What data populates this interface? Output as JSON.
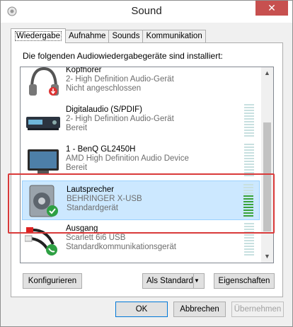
{
  "window": {
    "title": "Sound",
    "close_glyph": "✕"
  },
  "tabs": [
    {
      "label": "Wiedergabe",
      "active": true
    },
    {
      "label": "Aufnahme"
    },
    {
      "label": "Sounds"
    },
    {
      "label": "Kommunikation"
    }
  ],
  "instructions": "Die folgenden Audiowiedergabegeräte sind installiert:",
  "devices": [
    {
      "name": "Kopfhörer",
      "line1": "2- High Definition Audio-Gerät",
      "line2": "Nicht angeschlossen",
      "icon": "headphones-icon",
      "status_icon": "down-arrow-badge-icon"
    },
    {
      "name": "Digitalaudio (S/PDIF)",
      "line1": "2- High Definition Audio-Gerät",
      "line2": "Bereit",
      "icon": "digital-audio-icon"
    },
    {
      "name": "1 - BenQ GL2450H",
      "line1": "AMD High Definition Audio Device",
      "line2": "Bereit",
      "icon": "monitor-icon"
    },
    {
      "name": "Lautsprecher",
      "line1": "BEHRINGER X-USB",
      "line2": "Standardgerät",
      "icon": "speaker-icon",
      "status_icon": "checkmark-badge-icon",
      "selected": true,
      "level": 0.65
    },
    {
      "name": "Ausgang",
      "line1": "Scarlett 6i6 USB",
      "line2": "Standardkommunikationsgerät",
      "icon": "rca-cable-icon",
      "status_icon": "phone-badge-icon"
    }
  ],
  "buttons": {
    "configure": "Konfigurieren",
    "set_default": "Als Standard",
    "properties": "Eigenschaften",
    "ok": "OK",
    "cancel": "Abbrechen",
    "apply": "Übernehmen"
  },
  "colors": {
    "selection": "#cce8ff",
    "highlight_frame": "#d93a3a",
    "meter_on": "#3aa33a",
    "close_button": "#c7504f"
  }
}
